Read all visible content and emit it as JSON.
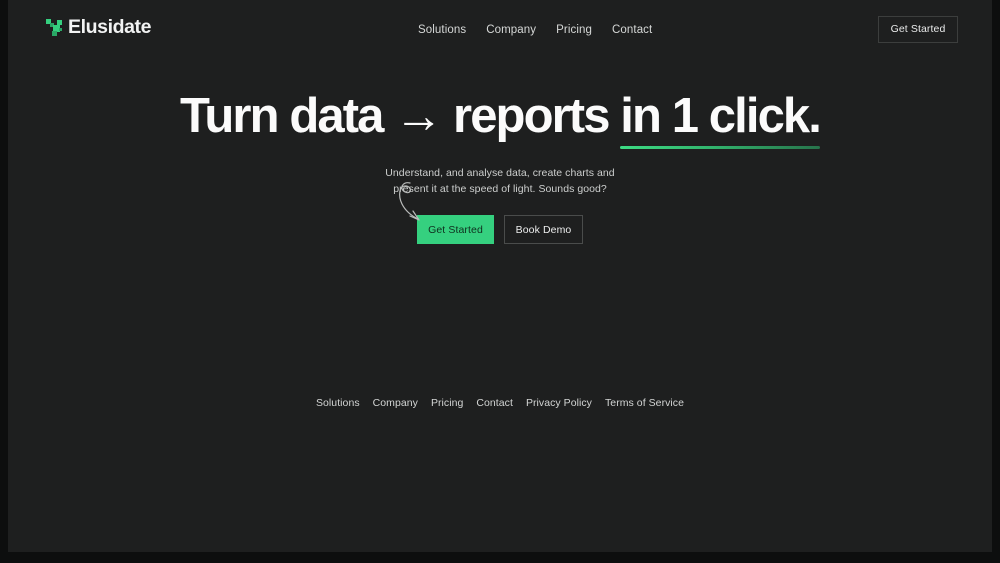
{
  "brand": {
    "name": "Elusidate",
    "mark_icon": "sprout-logo-icon",
    "accent_color": "#35d07f"
  },
  "header": {
    "nav": [
      {
        "label": "Solutions"
      },
      {
        "label": "Company"
      },
      {
        "label": "Pricing"
      },
      {
        "label": "Contact"
      }
    ],
    "cta_label": "Get Started"
  },
  "hero": {
    "title_part1": "Turn data ",
    "title_arrow": "→",
    "title_part2": " reports ",
    "title_highlight": "in 1 click.",
    "subtitle_line1": "Understand, and analyse data, create charts and",
    "subtitle_line2": "present it at the speed of light. Sounds good?",
    "primary_cta_label": "Get Started",
    "secondary_cta_label": "Book Demo",
    "arrow_icon": "curly-arrow-icon",
    "underline_color": "#3ddc84"
  },
  "footer": {
    "links": [
      {
        "label": "Solutions"
      },
      {
        "label": "Company"
      },
      {
        "label": "Pricing"
      },
      {
        "label": "Contact"
      },
      {
        "label": "Privacy Policy"
      },
      {
        "label": "Terms of Service"
      }
    ]
  },
  "theme": {
    "background": "#1e1f1f",
    "frame_background": "#0d0e0e",
    "text_primary": "#fbfbfb",
    "text_muted": "#cdcfce"
  }
}
